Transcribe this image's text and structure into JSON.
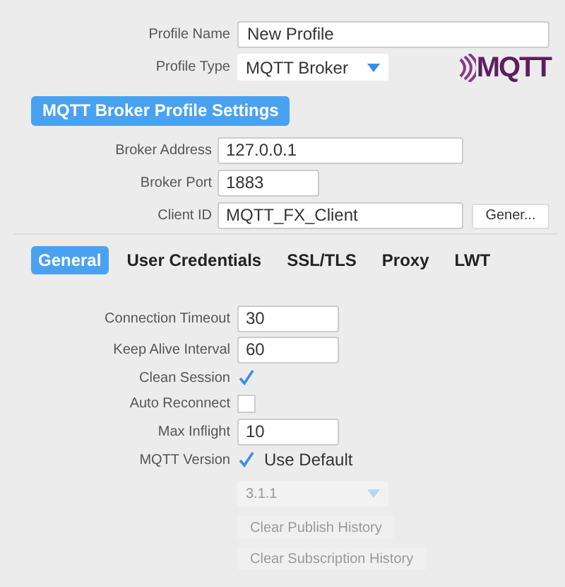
{
  "profile": [
    {
      "label": "Profile Name",
      "kind": "text",
      "value": "New Profile"
    },
    {
      "label": "Profile Type",
      "kind": "select",
      "value": "MQTT Broker"
    }
  ],
  "logo": "MQTT",
  "section_title": "MQTT Broker Profile Settings",
  "broker": [
    {
      "label": "Broker Address",
      "value": "127.0.0.1",
      "kind": "wide"
    },
    {
      "label": "Broker Port",
      "value": "1883",
      "kind": "short"
    },
    {
      "label": "Client ID",
      "value": "MQTT_FX_Client",
      "kind": "wide",
      "button": "Gener..."
    }
  ],
  "tabs": [
    {
      "label": "General",
      "selected": true
    },
    {
      "label": "User Credentials",
      "selected": false
    },
    {
      "label": "SSL/TLS",
      "selected": false
    },
    {
      "label": "Proxy",
      "selected": false
    },
    {
      "label": "LWT",
      "selected": false
    }
  ],
  "general": [
    {
      "label": "Connection Timeout",
      "kind": "text",
      "value": "30"
    },
    {
      "label": "Keep Alive Interval",
      "kind": "text",
      "value": "60"
    },
    {
      "label": "Clean Session",
      "kind": "check",
      "checked": true
    },
    {
      "label": "Auto Reconnect",
      "kind": "check",
      "checked": false
    },
    {
      "label": "Max Inflight",
      "kind": "text",
      "value": "10"
    },
    {
      "label": "MQTT Version",
      "kind": "check",
      "checked": true,
      "text": "Use Default"
    },
    {
      "kind": "select",
      "value": "3.1.1",
      "disabled": true
    },
    {
      "kind": "button",
      "value": "Clear Publish History",
      "disabled": true
    },
    {
      "kind": "button",
      "value": "Clear Subscription History",
      "disabled": true
    }
  ]
}
